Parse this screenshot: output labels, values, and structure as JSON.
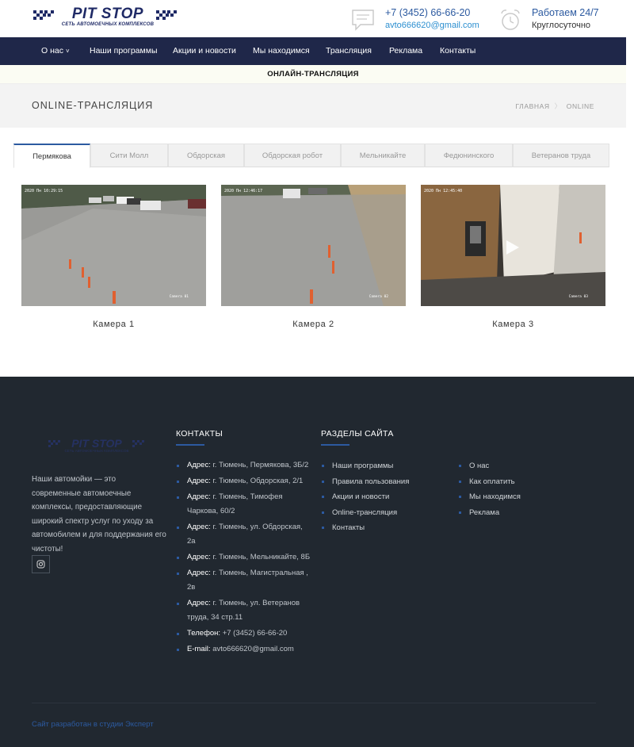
{
  "header": {
    "logo_text": "PIT STOP",
    "logo_tagline": "СЕТЬ АВТОМОЕЧНЫХ КОМПЛЕКСОВ",
    "phone": "+7 (3452) 66-66-20",
    "email": "avto666620@gmail.com",
    "hours_title": "Работаем 24/7",
    "hours_sub": "Круглосуточно",
    "accent_color": "#2c5aa0"
  },
  "nav": {
    "bg_color": "#1f2749",
    "items": [
      {
        "label": "О нас",
        "chevron": "˅"
      },
      {
        "label": "Наши программы"
      },
      {
        "label": "Акции и новости"
      },
      {
        "label": "Мы находимся"
      },
      {
        "label": "Трансляция"
      },
      {
        "label": "Реклама"
      },
      {
        "label": "Контакты"
      }
    ]
  },
  "live_banner": "ОНЛАЙН-ТРАНСЛЯЦИЯ",
  "page_title": "ONLINE-ТРАНСЛЯЦИЯ",
  "breadcrumbs": {
    "home": "ГЛАВНАЯ",
    "separator": "〉",
    "current": "ONLINE"
  },
  "tabs": [
    {
      "label": "Пермякова",
      "active": true
    },
    {
      "label": "Сити Молл"
    },
    {
      "label": "Обдорская"
    },
    {
      "label": "Обдорская робот"
    },
    {
      "label": "Мельникайте"
    },
    {
      "label": "Федюнинского"
    },
    {
      "label": "Ветеранов труда"
    }
  ],
  "cameras": [
    {
      "label": "Камера 1",
      "timestamp": "2020 Пн 10:29:15",
      "tag": "Camera 01"
    },
    {
      "label": "Камера 2",
      "timestamp": "2020 Пн 12:46:17",
      "tag": "Camera 02"
    },
    {
      "label": "Камера 3",
      "timestamp": "2020 Пн 12:45:40",
      "tag": "Camera 03"
    }
  ],
  "footer": {
    "logo_text": "PIT STOP",
    "logo_tagline": "СЕТЬ АВТОМОЕЧНЫХ КОМПЛЕКСОВ",
    "about": "Наши автомойки — это современные автомоечные комплексы, предоставляющие широкий спектр услуг по уходу за автомобилем и для поддержания его чистоты!",
    "social_icon": "instagram-icon",
    "contacts_heading": "КОНТАКТЫ",
    "contacts": [
      {
        "key": "Адрес:",
        "value": " г. Тюмень, Пермякова, 3Б/2"
      },
      {
        "key": "Адрес:",
        "value": " г. Тюмень, Обдорская, 2/1"
      },
      {
        "key": "Адрес:",
        "value": " г. Тюмень, Тимофея Чаркова, 60/2"
      },
      {
        "key": "Адрес:",
        "value": " г. Тюмень, ул. Обдорская, 2а"
      },
      {
        "key": "Адрес:",
        "value": " г. Тюмень, Мельникайте, 8Б"
      },
      {
        "key": "Адрес:",
        "value": " г. Тюмень, Магистральная , 2в"
      },
      {
        "key": "Адрес:",
        "value": " г. Тюмень, ул. Ветеранов труда, 34 стр.11"
      },
      {
        "key": "Телефон:",
        "value": " +7 (3452) 66-66-20"
      },
      {
        "key": "E-mail:",
        "value": " avto666620@gmail.com"
      }
    ],
    "sections_heading": "РАЗДЕЛЫ САЙТА",
    "sections_col1": [
      "Наши программы",
      "Правила пользования",
      "Акции и новости",
      "Online-трансляция",
      "Контакты"
    ],
    "sections_col2": [
      "О нас",
      "Как оплатить",
      "Мы находимся",
      "Реклама"
    ],
    "credit": "Сайт разработан в студии Эксперт"
  }
}
